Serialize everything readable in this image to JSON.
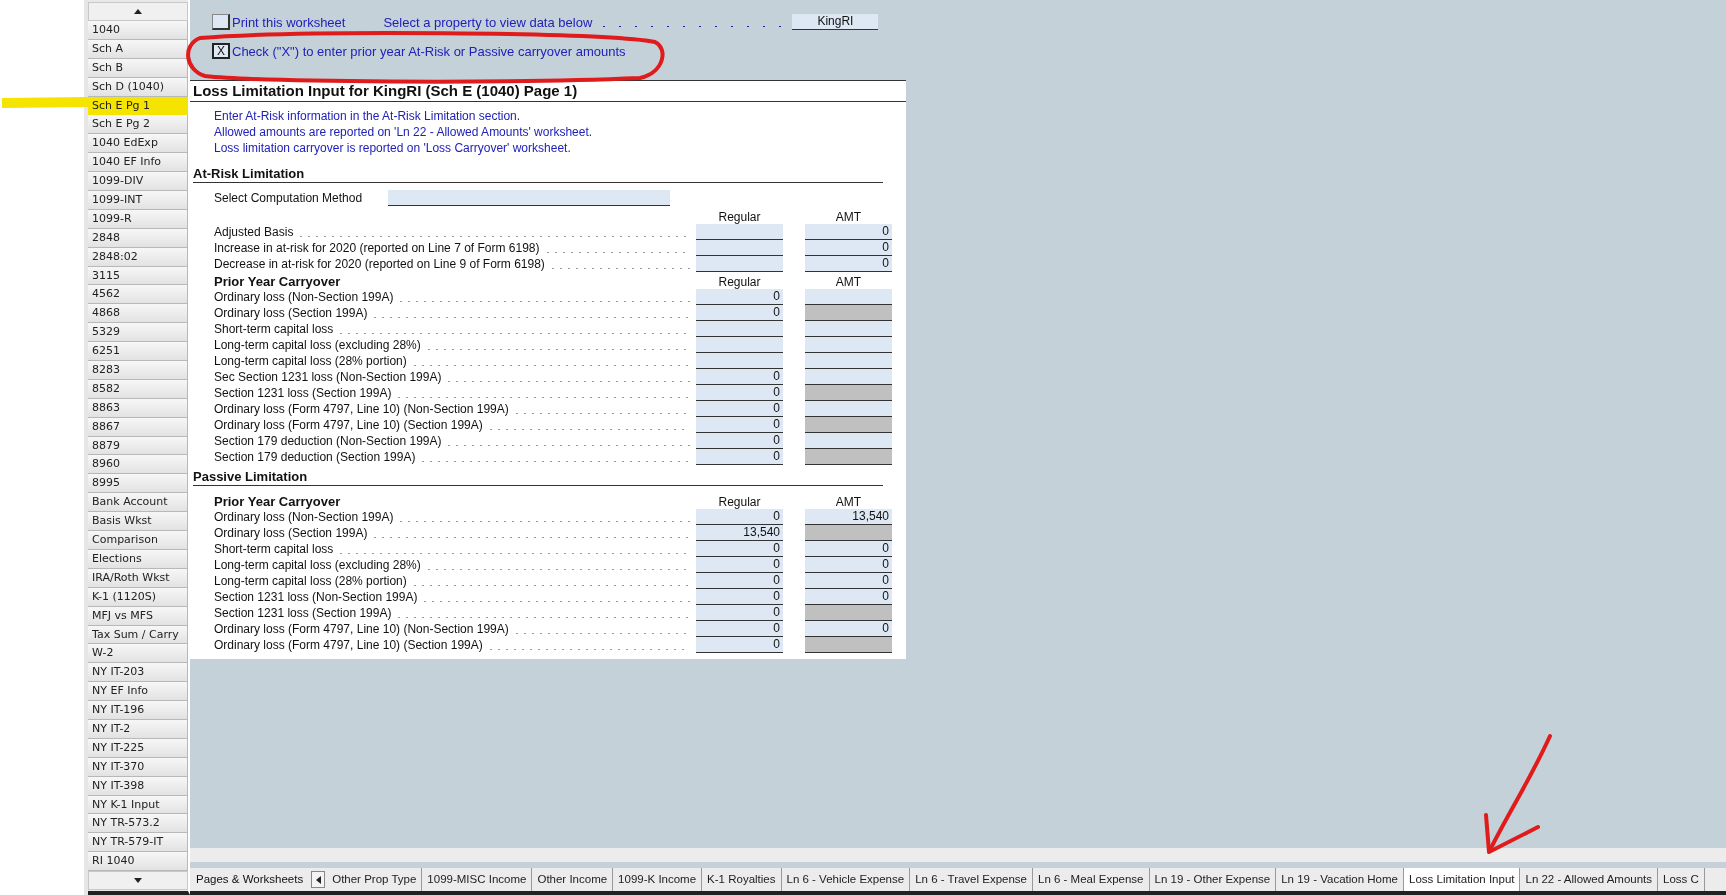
{
  "sidebar": {
    "items": [
      {
        "label": "1040",
        "selected": false
      },
      {
        "label": "Sch A",
        "selected": false
      },
      {
        "label": "Sch B",
        "selected": false
      },
      {
        "label": "Sch D (1040)",
        "selected": false
      },
      {
        "label": "Sch E Pg 1",
        "selected": true
      },
      {
        "label": "Sch E Pg 2",
        "selected": false
      },
      {
        "label": "1040 EdExp",
        "selected": false
      },
      {
        "label": "1040 EF Info",
        "selected": false
      },
      {
        "label": "1099-DIV",
        "selected": false
      },
      {
        "label": "1099-INT",
        "selected": false
      },
      {
        "label": "1099-R",
        "selected": false
      },
      {
        "label": "2848",
        "selected": false
      },
      {
        "label": "2848:02",
        "selected": false
      },
      {
        "label": "3115",
        "selected": false
      },
      {
        "label": "4562",
        "selected": false
      },
      {
        "label": "4868",
        "selected": false
      },
      {
        "label": "5329",
        "selected": false
      },
      {
        "label": "6251",
        "selected": false
      },
      {
        "label": "8283",
        "selected": false
      },
      {
        "label": "8582",
        "selected": false
      },
      {
        "label": "8863",
        "selected": false
      },
      {
        "label": "8867",
        "selected": false
      },
      {
        "label": "8879",
        "selected": false
      },
      {
        "label": "8960",
        "selected": false
      },
      {
        "label": "8995",
        "selected": false
      },
      {
        "label": "Bank Account",
        "selected": false
      },
      {
        "label": "Basis Wkst",
        "selected": false
      },
      {
        "label": "Comparison",
        "selected": false
      },
      {
        "label": "Elections",
        "selected": false
      },
      {
        "label": "IRA/Roth Wkst",
        "selected": false
      },
      {
        "label": "K-1 (1120S)",
        "selected": false
      },
      {
        "label": "MFJ vs MFS",
        "selected": false
      },
      {
        "label": "Tax Sum / Carry",
        "selected": false
      },
      {
        "label": "W-2",
        "selected": false
      },
      {
        "label": "NY IT-203",
        "selected": false
      },
      {
        "label": "NY EF Info",
        "selected": false
      },
      {
        "label": "NY IT-196",
        "selected": false
      },
      {
        "label": "NY IT-2",
        "selected": false
      },
      {
        "label": "NY IT-225",
        "selected": false
      },
      {
        "label": "NY IT-370",
        "selected": false
      },
      {
        "label": "NY IT-398",
        "selected": false
      },
      {
        "label": "NY K-1 Input",
        "selected": false
      },
      {
        "label": "NY TR-573.2",
        "selected": false
      },
      {
        "label": "NY TR-579-IT",
        "selected": false
      },
      {
        "label": "RI 1040",
        "selected": false
      }
    ]
  },
  "top": {
    "print_checkbox": {
      "checked": false,
      "label": "Print this worksheet"
    },
    "property_prompt": "Select a property to view data below",
    "property_value": "KingRI",
    "carryover_checkbox": {
      "checked": true,
      "mark": "X",
      "label": "Check (\"X\") to enter prior year At-Risk or Passive carryover amounts"
    }
  },
  "form": {
    "title": "Loss Limitation Input for KingRI (Sch E (1040) Page 1)",
    "notes": [
      "Enter At-Risk information in the At-Risk Limitation section.",
      "Allowed amounts are reported on 'Ln 22 - Allowed Amounts' worksheet.",
      "Loss limitation carryover is reported on 'Loss Carryover' worksheet."
    ],
    "sections": [
      {
        "heading": "At-Risk Limitation",
        "blocks": [
          {
            "kind": "select",
            "label": "Select Computation Method"
          },
          {
            "kind": "table",
            "columns": [
              "Regular",
              "AMT"
            ],
            "rows": [
              {
                "label": "Adjusted Basis",
                "regular": {
                  "disabled": false
                },
                "amt": {
                  "value": "0",
                  "disabled": false
                }
              },
              {
                "label": "Increase in at-risk for 2020 (reported on Line 7 of Form 6198)",
                "regular": {
                  "disabled": false
                },
                "amt": {
                  "value": "0",
                  "disabled": false
                }
              },
              {
                "label": "Decrease in at-risk for 2020 (reported on Line 9 of Form 6198)",
                "regular": {
                  "disabled": false
                },
                "amt": {
                  "value": "0",
                  "disabled": false
                }
              }
            ]
          },
          {
            "kind": "table",
            "subheading": "Prior Year Carryover",
            "columns": [
              "Regular",
              "AMT"
            ],
            "rows": [
              {
                "label": "Ordinary loss (Non-Section 199A)",
                "regular": {
                  "value": "0",
                  "disabled": false
                },
                "amt": {
                  "disabled": false
                }
              },
              {
                "label": "Ordinary loss (Section 199A)",
                "regular": {
                  "value": "0",
                  "disabled": false
                },
                "amt": {
                  "disabled": true
                }
              },
              {
                "label": "Short-term capital loss",
                "regular": {
                  "disabled": false
                },
                "amt": {
                  "disabled": false
                }
              },
              {
                "label": "Long-term capital loss (excluding 28%)",
                "regular": {
                  "disabled": false
                },
                "amt": {
                  "disabled": false
                }
              },
              {
                "label": "Long-term capital loss (28% portion)",
                "regular": {
                  "disabled": false
                },
                "amt": {
                  "disabled": false
                }
              },
              {
                "label": "Sec Section 1231 loss (Non-Section 199A)",
                "regular": {
                  "value": "0",
                  "disabled": false
                },
                "amt": {
                  "disabled": false
                }
              },
              {
                "label": "Section 1231 loss (Section 199A)",
                "regular": {
                  "value": "0",
                  "disabled": false
                },
                "amt": {
                  "disabled": true
                }
              },
              {
                "label": "Ordinary loss (Form 4797, Line 10) (Non-Section 199A)",
                "regular": {
                  "value": "0",
                  "disabled": false
                },
                "amt": {
                  "disabled": false
                }
              },
              {
                "label": "Ordinary loss (Form 4797, Line 10) (Section 199A)",
                "regular": {
                  "value": "0",
                  "disabled": false
                },
                "amt": {
                  "disabled": true
                }
              },
              {
                "label": "Section 179 deduction (Non-Section 199A)",
                "regular": {
                  "value": "0",
                  "disabled": false
                },
                "amt": {
                  "disabled": false
                }
              },
              {
                "label": "Section 179 deduction (Section 199A)",
                "regular": {
                  "value": "0",
                  "disabled": false
                },
                "amt": {
                  "disabled": true
                }
              }
            ]
          }
        ]
      },
      {
        "heading": "Passive Limitation",
        "blocks": [
          {
            "kind": "table",
            "subheading": "Prior Year Carryover",
            "columns": [
              "Regular",
              "AMT"
            ],
            "rows": [
              {
                "label": "Ordinary loss (Non-Section 199A)",
                "regular": {
                  "value": "0",
                  "disabled": false
                },
                "amt": {
                  "value": "13,540",
                  "disabled": false
                }
              },
              {
                "label": "Ordinary loss (Section 199A)",
                "regular": {
                  "value": "13,540",
                  "disabled": false
                },
                "amt": {
                  "disabled": true
                }
              },
              {
                "label": "Short-term capital loss",
                "regular": {
                  "value": "0",
                  "disabled": false
                },
                "amt": {
                  "value": "0",
                  "disabled": false
                }
              },
              {
                "label": "Long-term capital loss (excluding 28%)",
                "regular": {
                  "value": "0",
                  "disabled": false
                },
                "amt": {
                  "value": "0",
                  "disabled": false
                }
              },
              {
                "label": "Long-term capital loss (28% portion)",
                "regular": {
                  "value": "0",
                  "disabled": false
                },
                "amt": {
                  "value": "0",
                  "disabled": false
                }
              },
              {
                "label": "Section 1231 loss (Non-Section 199A)",
                "regular": {
                  "value": "0",
                  "disabled": false
                },
                "amt": {
                  "value": "0",
                  "disabled": false
                }
              },
              {
                "label": "Section 1231 loss (Section 199A)",
                "regular": {
                  "value": "0",
                  "disabled": false
                },
                "amt": {
                  "disabled": true
                }
              },
              {
                "label": "Ordinary loss (Form 4797, Line 10) (Non-Section 199A)",
                "regular": {
                  "value": "0",
                  "disabled": false
                },
                "amt": {
                  "value": "0",
                  "disabled": false
                }
              },
              {
                "label": "Ordinary loss (Form 4797, Line 10) (Section 199A)",
                "regular": {
                  "value": "0",
                  "disabled": false
                },
                "amt": {
                  "disabled": true
                }
              }
            ]
          }
        ]
      }
    ]
  },
  "sheet_tabs": {
    "label": "Pages & Worksheets",
    "tabs": [
      {
        "label": "Other Prop Type",
        "selected": false
      },
      {
        "label": "1099-MISC Income",
        "selected": false
      },
      {
        "label": "Other Income",
        "selected": false
      },
      {
        "label": "1099-K Income",
        "selected": false
      },
      {
        "label": "K-1 Royalties",
        "selected": false
      },
      {
        "label": "Ln 6 - Vehicle Expense",
        "selected": false
      },
      {
        "label": "Ln 6 - Travel Expense",
        "selected": false
      },
      {
        "label": "Ln 6 - Meal Expense",
        "selected": false
      },
      {
        "label": "Ln 19 - Other Expense",
        "selected": false
      },
      {
        "label": "Ln 19 - Vacation Home",
        "selected": false
      },
      {
        "label": "Loss Limitation Input",
        "selected": true
      },
      {
        "label": "Ln 22 - Allowed Amounts",
        "selected": false
      },
      {
        "label": "Loss C",
        "selected": false
      }
    ]
  }
}
